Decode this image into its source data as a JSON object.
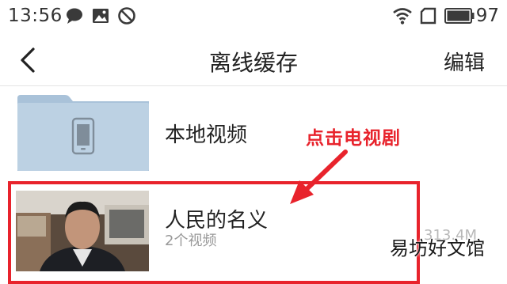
{
  "status_bar": {
    "time": "13:56",
    "battery": "97"
  },
  "nav": {
    "title": "离线缓存",
    "edit_label": "编辑"
  },
  "local": {
    "label": "本地视频"
  },
  "annotation": {
    "text": "点击电视剧",
    "color": "#e8232c"
  },
  "item": {
    "title": "人民的名义",
    "count": "2个视频",
    "size": "313.4M"
  },
  "watermark": "易坊好文馆",
  "colors": {
    "accent": "#e8232c",
    "thumb_bg": "#bcd1e3",
    "thumb_tab": "#a9c2d9"
  }
}
